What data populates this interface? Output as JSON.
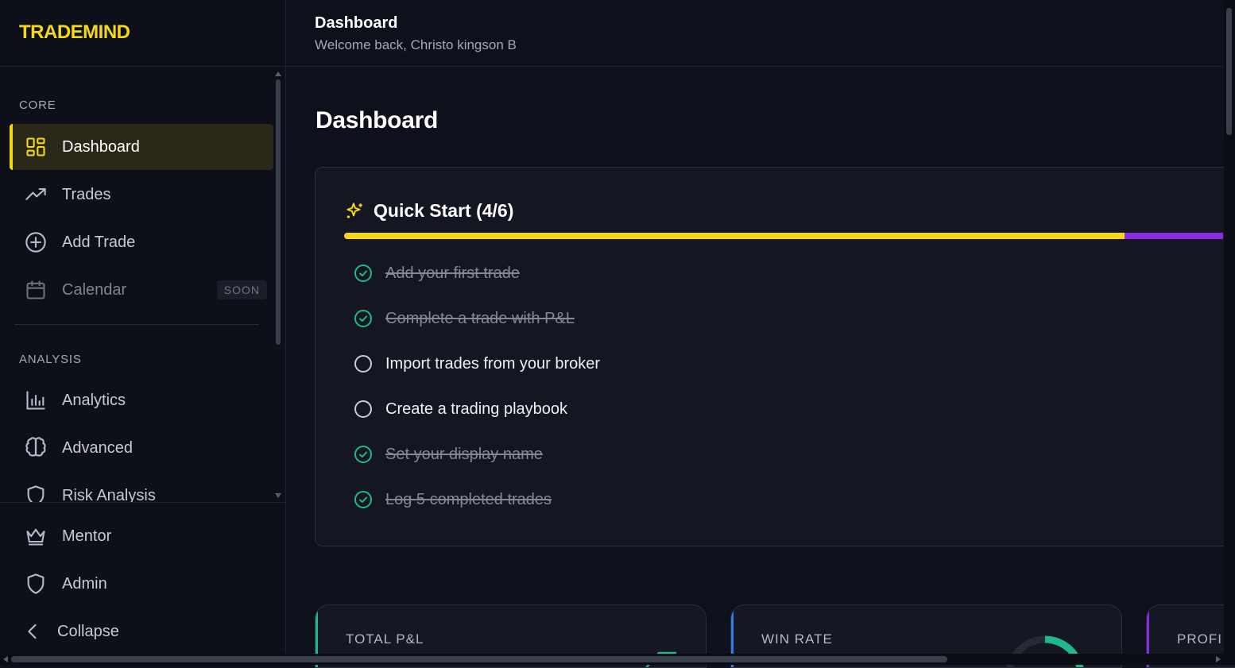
{
  "app": {
    "brand": "TRADEMIND"
  },
  "colors": {
    "accent": "#f6d816",
    "success": "#1fb888",
    "progress_rest": "#8a2be2",
    "win_rate_accent": "#2f7fe6",
    "profit_accent": "#8a2be2"
  },
  "sidebar": {
    "sections": {
      "core": "CORE",
      "analysis": "ANALYSIS"
    },
    "items": [
      {
        "label": "Dashboard",
        "icon": "layout-grid-icon",
        "active": true
      },
      {
        "label": "Trades",
        "icon": "trending-up-icon"
      },
      {
        "label": "Add Trade",
        "icon": "plus-circle-icon"
      },
      {
        "label": "Calendar",
        "icon": "calendar-icon",
        "badge": "SOON",
        "disabled": true
      },
      {
        "label": "Analytics",
        "icon": "bar-chart-icon"
      },
      {
        "label": "Advanced",
        "icon": "brain-icon"
      },
      {
        "label": "Risk Analysis",
        "icon": "shield-icon"
      }
    ],
    "bottom_items": [
      {
        "label": "Mentor",
        "icon": "crown-icon"
      },
      {
        "label": "Admin",
        "icon": "shield-icon"
      },
      {
        "label": "Collapse",
        "icon": "chevron-left-icon"
      }
    ]
  },
  "header": {
    "title": "Dashboard",
    "subtitle": "Welcome back, Christo kingson B"
  },
  "main": {
    "page_title": "Dashboard",
    "quick_start": {
      "title": "Quick Start (4/6)",
      "completed": 4,
      "total": 6,
      "tasks": [
        {
          "label": "Add your first trade",
          "done": true
        },
        {
          "label": "Complete a trade with P&L",
          "done": true
        },
        {
          "label": "Import trades from your broker",
          "done": false
        },
        {
          "label": "Create a trading playbook",
          "done": false
        },
        {
          "label": "Set your display name",
          "done": true
        },
        {
          "label": "Log 5 completed trades",
          "done": true
        }
      ]
    },
    "stats": [
      {
        "label": "TOTAL P&L"
      },
      {
        "label": "WIN RATE"
      },
      {
        "label": "PROFI"
      }
    ]
  }
}
